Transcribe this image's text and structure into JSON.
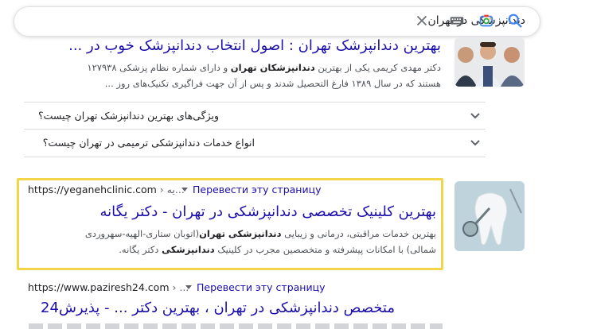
{
  "search": {
    "query": "دندانپزشکی در تهران"
  },
  "result1": {
    "title": "بهترین دندانپزشک تهران : اصول انتخاب دندانپزشک خوب در ...",
    "snippet_line1_pre": "دکتر مهدی کریمی یکی از بهترین ",
    "snippet_line1_bold1": "دندانپزشکان تهران",
    "snippet_line1_post": " و دارای شماره نظام پزشکی ۱۲۷۹۳۸",
    "snippet_line2": "هستند که در سال ۱۳۸۹ فارغ التحصیل شدند و پس از آن جهت فراگیری تکنیک‌های روز ..."
  },
  "questions": [
    {
      "label": "ویژگی‌های بهترین دندانپزشک تهران چیست؟"
    },
    {
      "label": "انواع خدمات دندانپزشکی ترمیمی در تهران چیست؟"
    }
  ],
  "result2": {
    "url": "https://yeganehclinic.com",
    "crumb": " › یه...",
    "translate": "Перевести эту страницу",
    "title": "بهترین کلینیک تخصصی دندانپزشکی در تهران - دکتر یگانه",
    "line1_pre": "بهترین خدمات مراقبتی، درمانی و زیبایی ",
    "line1_bold": "دندانپزشکی تهران",
    "line1_post": "(اتوبان ستاری-الهیه-سهروردی",
    "line2_pre": "شمالی) با امکانات پیشرفته و متخصصین مجرب در کلینیک ",
    "line2_bold": "دندانپزشکی",
    "line2_post": " دکتر یگانه."
  },
  "result3": {
    "url": "https://www.paziresh24.com",
    "crumb": " › ...",
    "translate": "Перевести эту страницу",
    "title": "متخصص دندانپزشکی در تهران ، بهترین دکتر ... - پذیرش24"
  },
  "colors": {
    "link": "#1a0dab",
    "highlight": "#f3d54a"
  }
}
